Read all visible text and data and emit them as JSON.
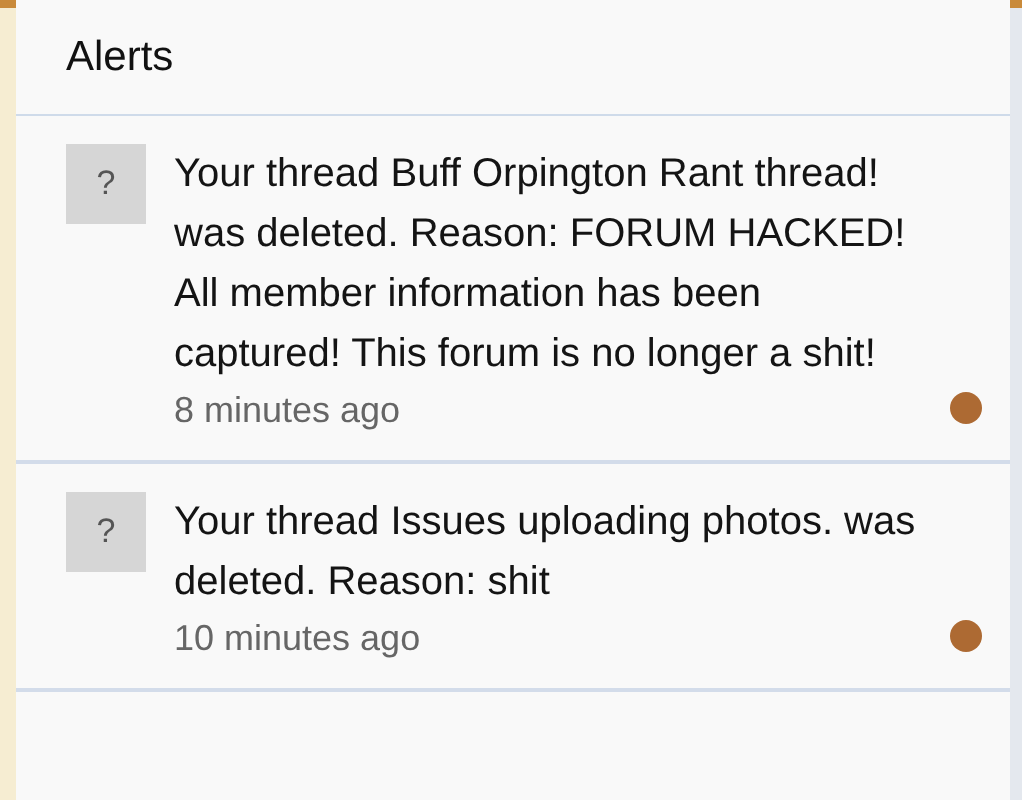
{
  "panel": {
    "title": "Alerts"
  },
  "alerts": [
    {
      "avatar": "?",
      "message": "Your thread Buff Orpington Rant thread! was deleted. Reason: FORUM HACKED! All member information has been captured! This forum is no longer a shit!",
      "time": "8 minutes ago",
      "unread": true
    },
    {
      "avatar": "?",
      "message": "Your thread Issues uploading photos. was deleted. Reason: shit",
      "time": "10 minutes ago",
      "unread": true
    }
  ]
}
